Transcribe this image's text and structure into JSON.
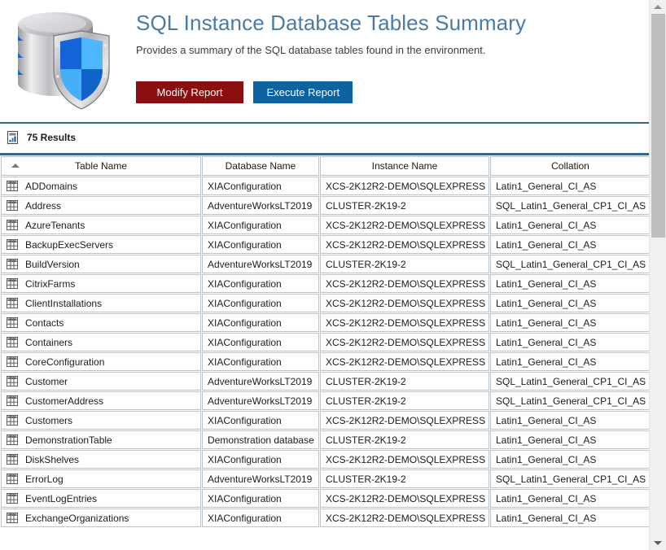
{
  "header": {
    "title": "SQL Instance Database Tables Summary",
    "description": "Provides a summary of the SQL database tables found in the environment.",
    "logo_icon": "database-shield-icon",
    "buttons": {
      "modify": "Modify Report",
      "execute": "Execute Report"
    },
    "colors": {
      "title": "#4a7ba6",
      "modify_button": "#8b0f10",
      "execute_button": "#0c639f",
      "rule": "#31678e"
    }
  },
  "results": {
    "icon": "report-chart-icon",
    "label": "75 Results",
    "count": 75
  },
  "table": {
    "sort": {
      "column": "Table Name",
      "direction": "ascending",
      "icon": "sort-ascending-icon"
    },
    "row_icon": "grid-table-icon",
    "columns": [
      "Table Name",
      "Database Name",
      "Instance Name",
      "Collation"
    ],
    "rows": [
      [
        "ADDomains",
        "XIAConfiguration",
        "XCS-2K12R2-DEMO\\SQLEXPRESS",
        "Latin1_General_CI_AS"
      ],
      [
        "Address",
        "AdventureWorksLT2019",
        "CLUSTER-2K19-2",
        "SQL_Latin1_General_CP1_CI_AS"
      ],
      [
        "AzureTenants",
        "XIAConfiguration",
        "XCS-2K12R2-DEMO\\SQLEXPRESS",
        "Latin1_General_CI_AS"
      ],
      [
        "BackupExecServers",
        "XIAConfiguration",
        "XCS-2K12R2-DEMO\\SQLEXPRESS",
        "Latin1_General_CI_AS"
      ],
      [
        "BuildVersion",
        "AdventureWorksLT2019",
        "CLUSTER-2K19-2",
        "SQL_Latin1_General_CP1_CI_AS"
      ],
      [
        "CitrixFarms",
        "XIAConfiguration",
        "XCS-2K12R2-DEMO\\SQLEXPRESS",
        "Latin1_General_CI_AS"
      ],
      [
        "ClientInstallations",
        "XIAConfiguration",
        "XCS-2K12R2-DEMO\\SQLEXPRESS",
        "Latin1_General_CI_AS"
      ],
      [
        "Contacts",
        "XIAConfiguration",
        "XCS-2K12R2-DEMO\\SQLEXPRESS",
        "Latin1_General_CI_AS"
      ],
      [
        "Containers",
        "XIAConfiguration",
        "XCS-2K12R2-DEMO\\SQLEXPRESS",
        "Latin1_General_CI_AS"
      ],
      [
        "CoreConfiguration",
        "XIAConfiguration",
        "XCS-2K12R2-DEMO\\SQLEXPRESS",
        "Latin1_General_CI_AS"
      ],
      [
        "Customer",
        "AdventureWorksLT2019",
        "CLUSTER-2K19-2",
        "SQL_Latin1_General_CP1_CI_AS"
      ],
      [
        "CustomerAddress",
        "AdventureWorksLT2019",
        "CLUSTER-2K19-2",
        "SQL_Latin1_General_CP1_CI_AS"
      ],
      [
        "Customers",
        "XIAConfiguration",
        "XCS-2K12R2-DEMO\\SQLEXPRESS",
        "Latin1_General_CI_AS"
      ],
      [
        "DemonstrationTable",
        "Demonstration database",
        "CLUSTER-2K19-2",
        "Latin1_General_CI_AS"
      ],
      [
        "DiskShelves",
        "XIAConfiguration",
        "XCS-2K12R2-DEMO\\SQLEXPRESS",
        "Latin1_General_CI_AS"
      ],
      [
        "ErrorLog",
        "AdventureWorksLT2019",
        "CLUSTER-2K19-2",
        "SQL_Latin1_General_CP1_CI_AS"
      ],
      [
        "EventLogEntries",
        "XIAConfiguration",
        "XCS-2K12R2-DEMO\\SQLEXPRESS",
        "Latin1_General_CI_AS"
      ],
      [
        "ExchangeOrganizations",
        "XIAConfiguration",
        "XCS-2K12R2-DEMO\\SQLEXPRESS",
        "Latin1_General_CI_AS"
      ]
    ]
  },
  "scrollbar": {
    "up_icon": "scroll-up-arrow-icon",
    "down_icon": "scroll-down-arrow-icon"
  }
}
